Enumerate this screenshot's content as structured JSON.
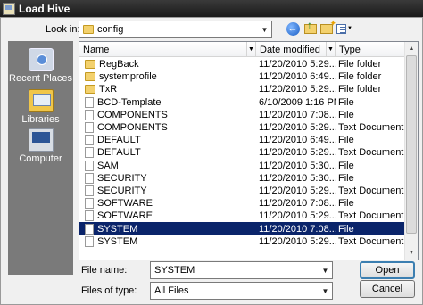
{
  "window": {
    "title": "Load Hive"
  },
  "toolbar": {
    "look_in_label": "Look in:",
    "look_in_value": "config"
  },
  "places": [
    {
      "label": "Recent Places",
      "icon": "recent-places-icon"
    },
    {
      "label": "Libraries",
      "icon": "libraries-icon"
    },
    {
      "label": "Computer",
      "icon": "computer-icon"
    }
  ],
  "columns": {
    "name": "Name",
    "date": "Date modified",
    "type": "Type"
  },
  "files": [
    {
      "name": "RegBack",
      "date": "11/20/2010 5:29...",
      "type": "File folder",
      "kind": "folder"
    },
    {
      "name": "systemprofile",
      "date": "11/20/2010 6:49...",
      "type": "File folder",
      "kind": "folder"
    },
    {
      "name": "TxR",
      "date": "11/20/2010 5:29...",
      "type": "File folder",
      "kind": "folder"
    },
    {
      "name": "BCD-Template",
      "date": "6/10/2009 1:16 PM",
      "type": "File",
      "kind": "file"
    },
    {
      "name": "COMPONENTS",
      "date": "11/20/2010 7:08...",
      "type": "File",
      "kind": "file"
    },
    {
      "name": "COMPONENTS",
      "date": "11/20/2010 5:29...",
      "type": "Text Document",
      "kind": "file"
    },
    {
      "name": "DEFAULT",
      "date": "11/20/2010 6:49...",
      "type": "File",
      "kind": "file"
    },
    {
      "name": "DEFAULT",
      "date": "11/20/2010 5:29...",
      "type": "Text Document",
      "kind": "file"
    },
    {
      "name": "SAM",
      "date": "11/20/2010 5:30...",
      "type": "File",
      "kind": "file"
    },
    {
      "name": "SECURITY",
      "date": "11/20/2010 5:30...",
      "type": "File",
      "kind": "file"
    },
    {
      "name": "SECURITY",
      "date": "11/20/2010 5:29...",
      "type": "Text Document",
      "kind": "file"
    },
    {
      "name": "SOFTWARE",
      "date": "11/20/2010 7:08...",
      "type": "File",
      "kind": "file"
    },
    {
      "name": "SOFTWARE",
      "date": "11/20/2010 5:29...",
      "type": "Text Document",
      "kind": "file"
    },
    {
      "name": "SYSTEM",
      "date": "11/20/2010 7:08...",
      "type": "File",
      "kind": "file",
      "selected": true
    },
    {
      "name": "SYSTEM",
      "date": "11/20/2010 5:29...",
      "type": "Text Document",
      "kind": "file"
    }
  ],
  "filename": {
    "label": "File name:",
    "value": "SYSTEM"
  },
  "filetype": {
    "label": "Files of type:",
    "value": "All Files"
  },
  "buttons": {
    "open": "Open",
    "cancel": "Cancel"
  },
  "colors": {
    "selection": "#0a246a",
    "places_bg": "#7a7a7a"
  }
}
